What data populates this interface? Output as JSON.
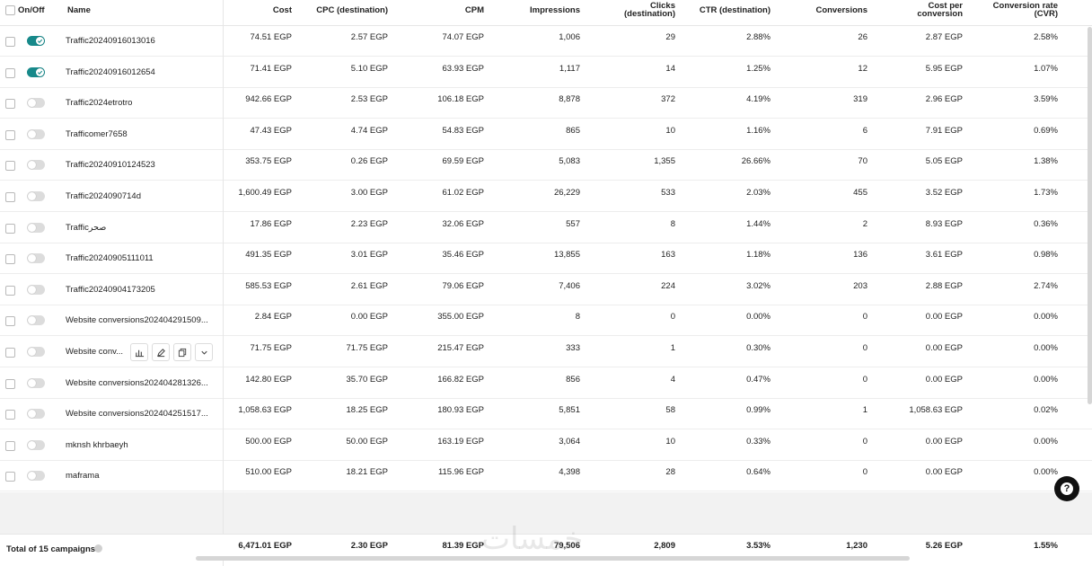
{
  "header": {
    "onoff": "On/Off",
    "name": "Name",
    "cost": "Cost",
    "cpc": "CPC (destination)",
    "cpm": "CPM",
    "impressions": "Impressions",
    "clicks_1": "Clicks",
    "clicks_2": "(destination)",
    "ctr": "CTR (destination)",
    "conversions": "Conversions",
    "cpa_1": "Cost per",
    "cpa_2": "conversion",
    "cvr_1": "Conversion rate",
    "cvr_2": "(CVR)"
  },
  "rows": [
    {
      "on": true,
      "name": "Traffic20240916013016",
      "cost": "74.51 EGP",
      "cpc": "2.57 EGP",
      "cpm": "74.07 EGP",
      "impressions": "1,006",
      "clicks": "29",
      "ctr": "2.88%",
      "conversions": "26",
      "cpa": "2.87 EGP",
      "cvr": "2.58%"
    },
    {
      "on": true,
      "name": "Traffic20240916012654",
      "cost": "71.41 EGP",
      "cpc": "5.10 EGP",
      "cpm": "63.93 EGP",
      "impressions": "1,117",
      "clicks": "14",
      "ctr": "1.25%",
      "conversions": "12",
      "cpa": "5.95 EGP",
      "cvr": "1.07%"
    },
    {
      "on": false,
      "name": "Traffic2024etrotro",
      "cost": "942.66 EGP",
      "cpc": "2.53 EGP",
      "cpm": "106.18 EGP",
      "impressions": "8,878",
      "clicks": "372",
      "ctr": "4.19%",
      "conversions": "319",
      "cpa": "2.96 EGP",
      "cvr": "3.59%"
    },
    {
      "on": false,
      "name": "Trafficomer7658",
      "cost": "47.43 EGP",
      "cpc": "4.74 EGP",
      "cpm": "54.83 EGP",
      "impressions": "865",
      "clicks": "10",
      "ctr": "1.16%",
      "conversions": "6",
      "cpa": "7.91 EGP",
      "cvr": "0.69%"
    },
    {
      "on": false,
      "name": "Traffic20240910124523",
      "cost": "353.75 EGP",
      "cpc": "0.26 EGP",
      "cpm": "69.59 EGP",
      "impressions": "5,083",
      "clicks": "1,355",
      "ctr": "26.66%",
      "conversions": "70",
      "cpa": "5.05 EGP",
      "cvr": "1.38%"
    },
    {
      "on": false,
      "name": "Traffic2024090714d",
      "cost": "1,600.49 EGP",
      "cpc": "3.00 EGP",
      "cpm": "61.02 EGP",
      "impressions": "26,229",
      "clicks": "533",
      "ctr": "2.03%",
      "conversions": "455",
      "cpa": "3.52 EGP",
      "cvr": "1.73%"
    },
    {
      "on": false,
      "name": "Trafficصحر",
      "cost": "17.86 EGP",
      "cpc": "2.23 EGP",
      "cpm": "32.06 EGP",
      "impressions": "557",
      "clicks": "8",
      "ctr": "1.44%",
      "conversions": "2",
      "cpa": "8.93 EGP",
      "cvr": "0.36%"
    },
    {
      "on": false,
      "name": "Traffic20240905111011",
      "cost": "491.35 EGP",
      "cpc": "3.01 EGP",
      "cpm": "35.46 EGP",
      "impressions": "13,855",
      "clicks": "163",
      "ctr": "1.18%",
      "conversions": "136",
      "cpa": "3.61 EGP",
      "cvr": "0.98%"
    },
    {
      "on": false,
      "name": "Traffic20240904173205",
      "cost": "585.53 EGP",
      "cpc": "2.61 EGP",
      "cpm": "79.06 EGP",
      "impressions": "7,406",
      "clicks": "224",
      "ctr": "3.02%",
      "conversions": "203",
      "cpa": "2.88 EGP",
      "cvr": "2.74%"
    },
    {
      "on": false,
      "name": "Website conversions202404291509...",
      "cost": "2.84 EGP",
      "cpc": "0.00 EGP",
      "cpm": "355.00 EGP",
      "impressions": "8",
      "clicks": "0",
      "ctr": "0.00%",
      "conversions": "0",
      "cpa": "0.00 EGP",
      "cvr": "0.00%"
    },
    {
      "on": false,
      "name": "Website conv...",
      "cost": "71.75 EGP",
      "cpc": "71.75 EGP",
      "cpm": "215.47 EGP",
      "impressions": "333",
      "clicks": "1",
      "ctr": "0.30%",
      "conversions": "0",
      "cpa": "0.00 EGP",
      "cvr": "0.00%",
      "hover": true
    },
    {
      "on": false,
      "name": "Website conversions202404281326...",
      "cost": "142.80 EGP",
      "cpc": "35.70 EGP",
      "cpm": "166.82 EGP",
      "impressions": "856",
      "clicks": "4",
      "ctr": "0.47%",
      "conversions": "0",
      "cpa": "0.00 EGP",
      "cvr": "0.00%"
    },
    {
      "on": false,
      "name": "Website conversions202404251517...",
      "cost": "1,058.63 EGP",
      "cpc": "18.25 EGP",
      "cpm": "180.93 EGP",
      "impressions": "5,851",
      "clicks": "58",
      "ctr": "0.99%",
      "conversions": "1",
      "cpa": "1,058.63 EGP",
      "cvr": "0.02%"
    },
    {
      "on": false,
      "name": "mknsh khrbaeyh",
      "cost": "500.00 EGP",
      "cpc": "50.00 EGP",
      "cpm": "163.19 EGP",
      "impressions": "3,064",
      "clicks": "10",
      "ctr": "0.33%",
      "conversions": "0",
      "cpa": "0.00 EGP",
      "cvr": "0.00%"
    },
    {
      "on": false,
      "name": "maframa",
      "cost": "510.00 EGP",
      "cpc": "18.21 EGP",
      "cpm": "115.96 EGP",
      "impressions": "4,398",
      "clicks": "28",
      "ctr": "0.64%",
      "conversions": "0",
      "cpa": "0.00 EGP",
      "cvr": "0.00%"
    }
  ],
  "footer": {
    "label": "Total of 15 campaigns",
    "cost": "6,471.01 EGP",
    "cpc": "2.30 EGP",
    "cpm": "81.39 EGP",
    "impressions": "79,506",
    "clicks": "2,809",
    "ctr": "3.53%",
    "conversions": "1,230",
    "cpa": "5.26 EGP",
    "cvr": "1.55%"
  },
  "row_tools": [
    "chart-icon",
    "edit-icon",
    "duplicate-icon",
    "chevron-down-icon"
  ],
  "help": "?",
  "watermark": "خمسات",
  "colors": {
    "toggle_on": "#17898a",
    "text": "#1f1f1f",
    "border": "#e6e6e6"
  }
}
